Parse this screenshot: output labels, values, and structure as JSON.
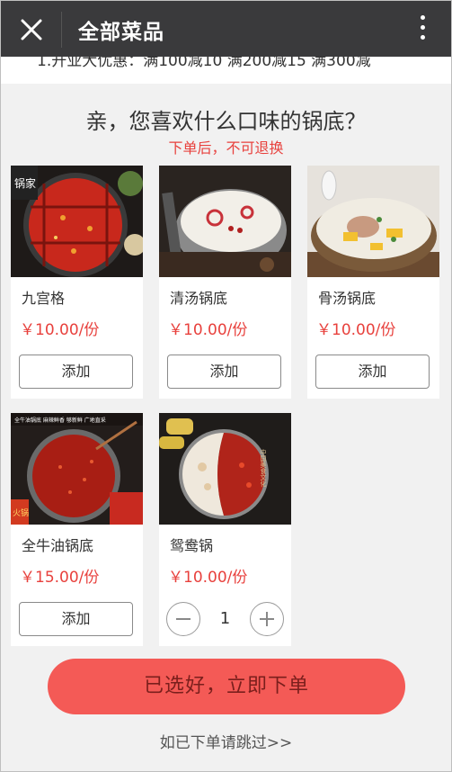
{
  "header": {
    "title": "全部菜品"
  },
  "promo": {
    "text": "1.开业大优惠：满100减10 满200减15 满300减"
  },
  "question": "亲，您喜欢什么口味的锅底？",
  "note": "下单后，不可退换",
  "products": [
    {
      "name": "九宫格",
      "price": "￥10.00/份",
      "action": "添加"
    },
    {
      "name": "清汤锅底",
      "price": "￥10.00/份",
      "action": "添加"
    },
    {
      "name": "骨汤锅底",
      "price": "￥10.00/份",
      "action": "添加"
    },
    {
      "name": "全牛油锅底",
      "price": "￥15.00/份",
      "action": "添加"
    },
    {
      "name": "鸳鸯锅",
      "price": "￥10.00/份",
      "quantity": "1"
    }
  ],
  "photo_labels": {
    "p1_logo": "锅家",
    "p4_banner": "全牛油锅底 麻辣鲜香 够新鲜 广地直采",
    "p4_side": "火锅",
    "p5_side": "中国美食文化"
  },
  "colors": {
    "accent": "#e8413d",
    "order_button": "#f45a56",
    "topbar": "#3a3a3c"
  },
  "footer": {
    "order_label": "已选好，立即下单",
    "skip_label": "如已下单请跳过>>"
  }
}
